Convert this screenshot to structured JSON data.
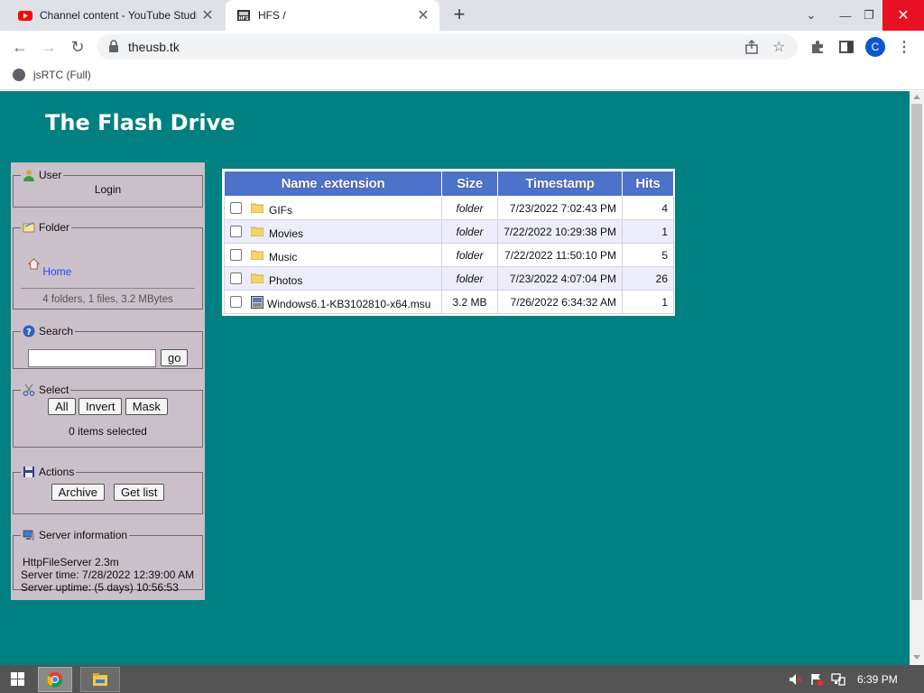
{
  "browser": {
    "tabs": [
      {
        "title": "Channel content - YouTube Studio",
        "favicon": "youtube-icon",
        "active": false
      },
      {
        "title": "HFS /",
        "favicon": "hfs-icon",
        "active": true
      }
    ],
    "url": "theusb.tk",
    "avatar_initial": "C",
    "bookmarks": [
      {
        "label": "jsRTC (Full)",
        "icon": "globe-icon"
      }
    ]
  },
  "site": {
    "title": "The Flash Drive"
  },
  "sidebar": {
    "user": {
      "legend": "User",
      "login": "Login"
    },
    "folder": {
      "legend": "Folder",
      "home": "Home",
      "info": "4 folders, 1 files, 3.2 MBytes"
    },
    "search": {
      "legend": "Search",
      "value": "",
      "go": "go"
    },
    "select": {
      "legend": "Select",
      "all": "All",
      "invert": "Invert",
      "mask": "Mask",
      "status": "0 items selected"
    },
    "actions": {
      "legend": "Actions",
      "archive": "Archive",
      "get_list": "Get list"
    },
    "server": {
      "legend": "Server information",
      "software": "HttpFileServer 2.3m",
      "time": "Server time: 7/28/2022 12:39:00 AM",
      "uptime": "Server uptime: (5 days) 10:56:53"
    }
  },
  "files": {
    "headers": [
      "Name .extension",
      "Size",
      "Timestamp",
      "Hits"
    ],
    "rows": [
      {
        "name": "GIFs",
        "size": "folder",
        "timestamp": "7/23/2022 7:02:43 PM",
        "hits": "4",
        "type": "folder"
      },
      {
        "name": "Movies",
        "size": "folder",
        "timestamp": "7/22/2022 10:29:38 PM",
        "hits": "1",
        "type": "folder"
      },
      {
        "name": "Music",
        "size": "folder",
        "timestamp": "7/22/2022 11:50:10 PM",
        "hits": "5",
        "type": "folder"
      },
      {
        "name": "Photos",
        "size": "folder",
        "timestamp": "7/23/2022 4:07:04 PM",
        "hits": "26",
        "type": "folder"
      },
      {
        "name": "Windows6.1-KB3102810-x64.msu",
        "size": "3.2 MB",
        "timestamp": "7/26/2022 6:34:32 AM",
        "hits": "1",
        "type": "file"
      }
    ]
  },
  "taskbar": {
    "clock": "6:39 PM"
  },
  "colors": {
    "page_bg": "#008080",
    "panel_bg": "#c9c0c9",
    "table_header": "#4c72c9",
    "link": "#2a44ff"
  }
}
